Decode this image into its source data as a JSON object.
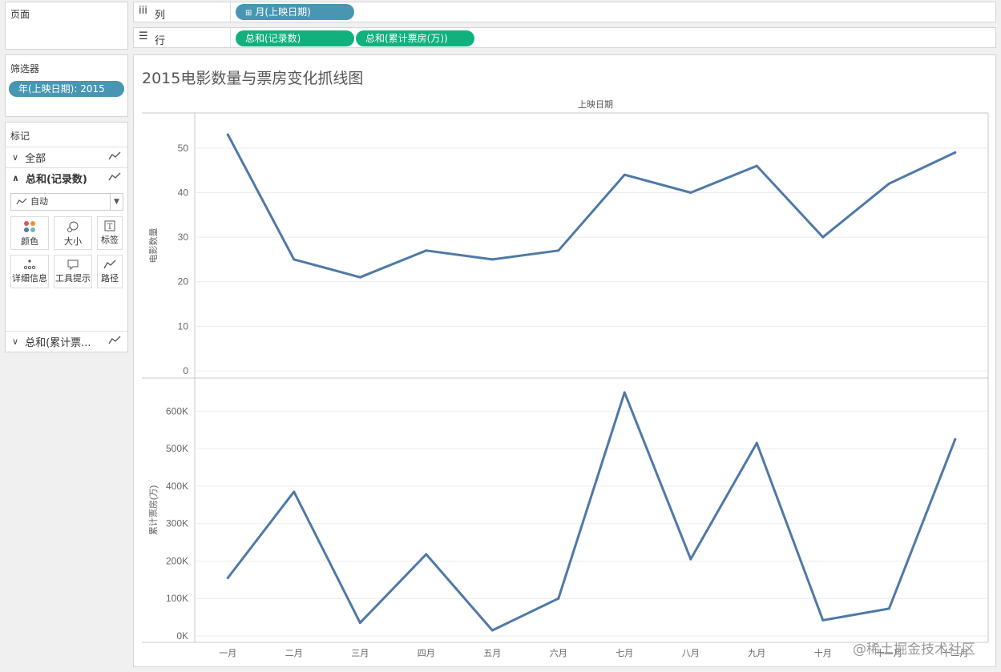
{
  "pages_panel": {
    "title": "页面"
  },
  "columns_shelf": {
    "label": "列",
    "pills": [
      "月(上映日期)"
    ]
  },
  "rows_shelf": {
    "label": "行",
    "pills": [
      "总和(记录数)",
      "总和(累计票房(万))"
    ]
  },
  "filters_panel": {
    "title": "筛选器",
    "pills": [
      "年(上映日期): 2015"
    ]
  },
  "marks_panel": {
    "title": "标记",
    "rows": [
      "全部",
      "总和(记录数)",
      "总和(累计票..."
    ],
    "mark_type": "自动",
    "buttons": [
      "颜色",
      "大小",
      "标签",
      "详细信息",
      "工具提示",
      "路径"
    ]
  },
  "watermark": "@稀土掘金技术社区",
  "colors": {
    "line": "#4e79a7",
    "pill_blue": "#4996b2",
    "pill_green": "#11b17d"
  },
  "chart_data": {
    "type": "line",
    "title": "2015电影数量与票房变化抓线图",
    "xlabel": "上映日期",
    "categories": [
      "一月",
      "二月",
      "三月",
      "四月",
      "五月",
      "六月",
      "七月",
      "八月",
      "九月",
      "十月",
      "十一月",
      "十二月"
    ],
    "panes": [
      {
        "ylabel": "电影数量",
        "ylim": [
          0,
          55
        ],
        "yticks": [
          0,
          10,
          20,
          30,
          40,
          50
        ],
        "ytick_labels": [
          "0",
          "10",
          "20",
          "30",
          "40",
          "50"
        ],
        "values": [
          53,
          25,
          21,
          27,
          25,
          27,
          44,
          40,
          46,
          30,
          42,
          49
        ]
      },
      {
        "ylabel": "累计票房(万)",
        "ylim": [
          0,
          650000
        ],
        "yticks": [
          0,
          100000,
          200000,
          300000,
          400000,
          500000,
          600000
        ],
        "ytick_labels": [
          "0K",
          "100K",
          "200K",
          "300K",
          "400K",
          "500K",
          "600K"
        ],
        "values": [
          155000,
          385000,
          35000,
          218000,
          15000,
          100000,
          650000,
          205000,
          515000,
          42000,
          73000,
          525000
        ]
      }
    ],
    "grid": true
  }
}
